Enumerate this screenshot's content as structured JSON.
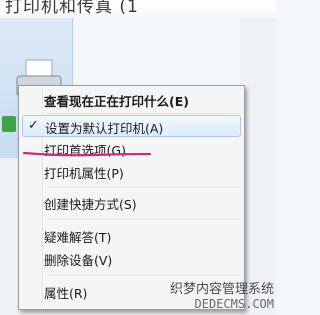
{
  "window": {
    "header_text": "打印机和传真 (1"
  },
  "context_menu": {
    "items": [
      {
        "label": "查看现在正在打印什么(E)",
        "bold": true,
        "checked": false,
        "highlighted": false
      },
      {
        "label": "设置为默认打印机(A)",
        "bold": false,
        "checked": true,
        "highlighted": true
      },
      {
        "label": "打印首选项(G)",
        "bold": false,
        "checked": false,
        "highlighted": false
      },
      {
        "label": "打印机属性(P)",
        "bold": false,
        "checked": false,
        "highlighted": false
      },
      {
        "label": "创建快捷方式(S)",
        "bold": false,
        "checked": false,
        "highlighted": false
      },
      {
        "label": "疑难解答(T)",
        "bold": false,
        "checked": false,
        "highlighted": false
      },
      {
        "label": "删除设备(V)",
        "bold": false,
        "checked": false,
        "highlighted": false
      },
      {
        "label": "属性(R)",
        "bold": false,
        "checked": false,
        "highlighted": false
      }
    ],
    "check_glyph": "✓"
  },
  "annotation": {
    "underline_color": "#c4307a"
  },
  "watermark": {
    "line1": "织梦内容管理系统",
    "line2": "DEDECMS.COM"
  }
}
